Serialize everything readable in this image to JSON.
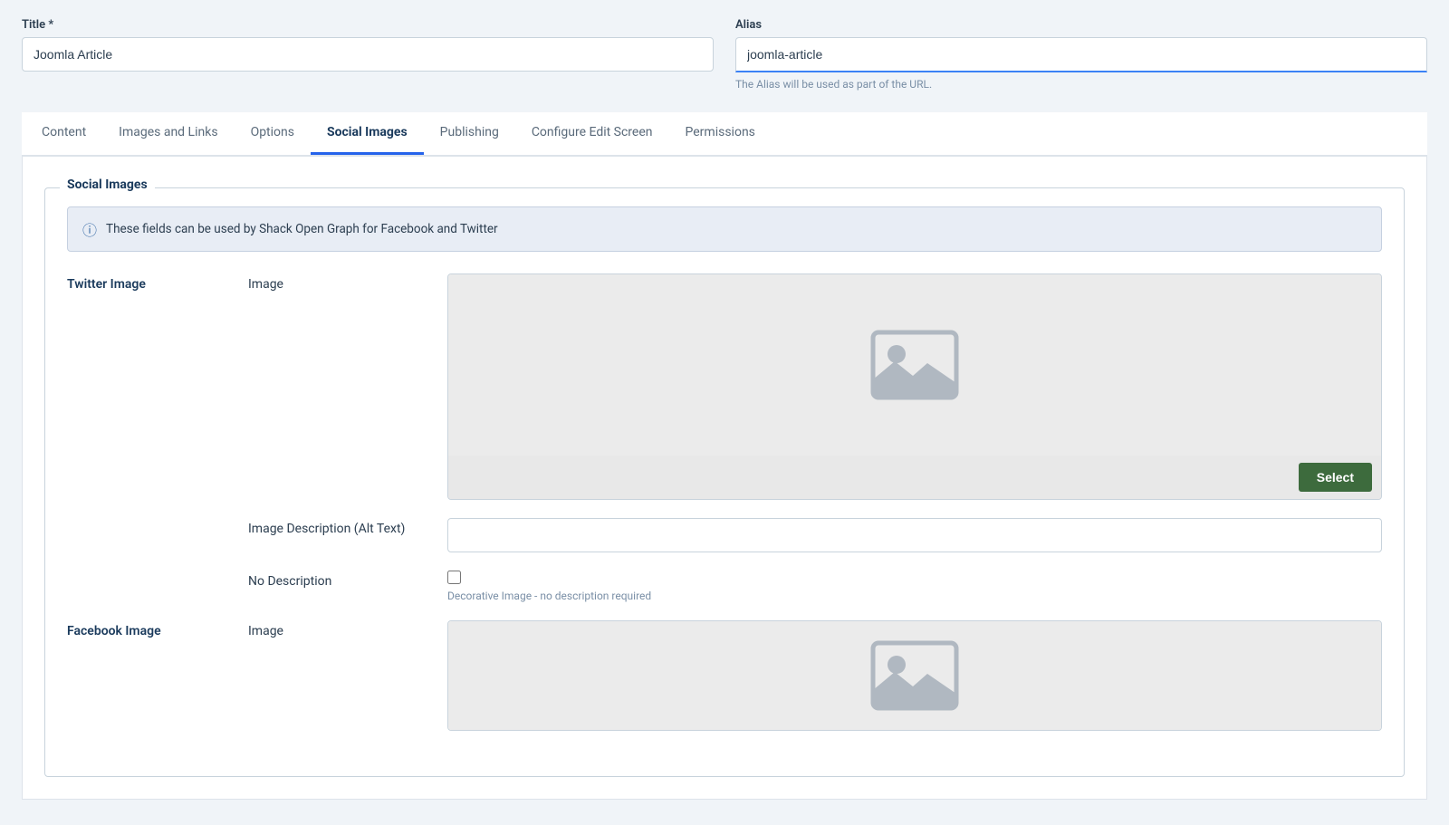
{
  "header": {
    "title_label": "Title *",
    "title_value": "Joomla Article",
    "alias_label": "Alias",
    "alias_value": "joomla-article",
    "alias_hint": "The Alias will be used as part of the URL."
  },
  "tabs": [
    {
      "id": "content",
      "label": "Content",
      "active": false
    },
    {
      "id": "images-links",
      "label": "Images and Links",
      "active": false
    },
    {
      "id": "options",
      "label": "Options",
      "active": false
    },
    {
      "id": "social-images",
      "label": "Social Images",
      "active": true
    },
    {
      "id": "publishing",
      "label": "Publishing",
      "active": false
    },
    {
      "id": "configure-edit-screen",
      "label": "Configure Edit Screen",
      "active": false
    },
    {
      "id": "permissions",
      "label": "Permissions",
      "active": false
    }
  ],
  "social_images": {
    "section_title": "Social Images",
    "info_message": "These fields can be used by Shack Open Graph for Facebook and Twitter",
    "twitter_image": {
      "section_label": "Twitter Image",
      "image_label": "Image",
      "select_button": "Select",
      "alt_text_label": "Image Description (Alt Text)",
      "alt_text_placeholder": "",
      "no_description_label": "No Description",
      "no_description_hint": "Decorative Image - no description required"
    },
    "facebook_image": {
      "section_label": "Facebook Image",
      "image_label": "Image"
    }
  }
}
